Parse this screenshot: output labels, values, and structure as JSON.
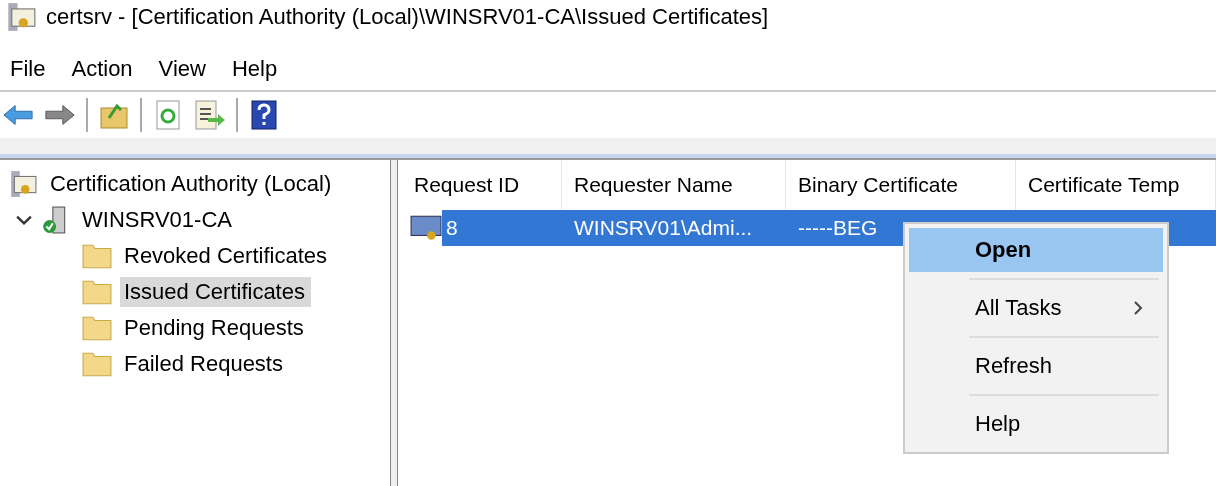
{
  "window": {
    "title": "certsrv - [Certification Authority (Local)\\WINSRV01-CA\\Issued Certificates]"
  },
  "menu_bar": [
    "File",
    "Action",
    "View",
    "Help"
  ],
  "toolbar": [
    {
      "kind": "back",
      "disabled": false
    },
    {
      "kind": "forward",
      "disabled": true
    },
    {
      "kind": "separator"
    },
    {
      "kind": "up",
      "disabled": false
    },
    {
      "kind": "separator"
    },
    {
      "kind": "refresh",
      "disabled": false
    },
    {
      "kind": "export",
      "disabled": false
    },
    {
      "kind": "separator"
    },
    {
      "kind": "help",
      "disabled": false
    }
  ],
  "tree": [
    {
      "label": "Certification Authority (Local)",
      "kind": "root",
      "selected": false,
      "children": [
        {
          "label": "WINSRV01-CA",
          "kind": "server",
          "selected": false,
          "expanded": true,
          "children": [
            {
              "label": "Revoked Certificates",
              "kind": "folder",
              "selected": false
            },
            {
              "label": "Issued Certificates",
              "kind": "folder",
              "selected": true
            },
            {
              "label": "Pending Requests",
              "kind": "folder",
              "selected": false
            },
            {
              "label": "Failed Requests",
              "kind": "folder",
              "selected": false
            }
          ]
        }
      ]
    }
  ],
  "table": {
    "columns": [
      "Request ID",
      "Requester Name",
      "Binary Certificate",
      "Certificate Temp"
    ],
    "rows": [
      {
        "cells": [
          "8",
          "WINSRV01\\Admi...",
          "-----BEG"
        ],
        "selected": true
      }
    ]
  },
  "context_menu": [
    {
      "label": "Open",
      "selected": true,
      "default": true,
      "submenu": false
    },
    {
      "label": "All Tasks",
      "selected": false,
      "default": false,
      "submenu": true
    },
    {
      "label": "Refresh",
      "selected": false,
      "default": false,
      "submenu": false
    },
    {
      "label": "Help",
      "selected": false,
      "default": false,
      "submenu": false
    }
  ]
}
